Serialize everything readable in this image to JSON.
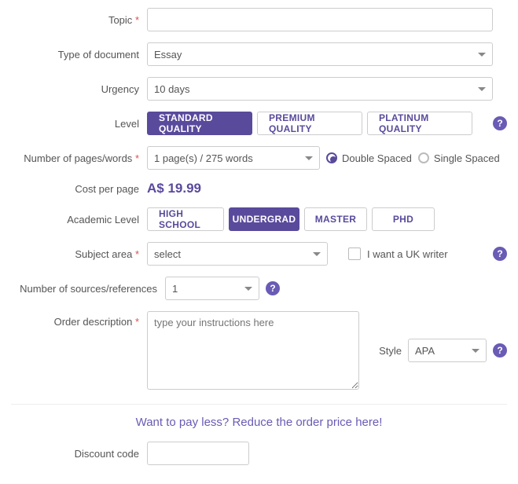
{
  "labels": {
    "topic": "Topic",
    "doc_type": "Type of document",
    "urgency": "Urgency",
    "level": "Level",
    "pages": "Number of pages/words",
    "cost": "Cost per page",
    "academic": "Academic Level",
    "subject": "Subject area",
    "sources": "Number of sources/references",
    "description": "Order description",
    "style": "Style",
    "discount": "Discount code"
  },
  "topic_value": "",
  "doc_type_value": "Essay",
  "urgency_value": "10 days",
  "quality_options": {
    "standard": "STANDARD QUALITY",
    "premium": "PREMIUM QUALITY",
    "platinum": "PLATINUM QUALITY"
  },
  "pages_value": "1 page(s) / 275 words",
  "spacing": {
    "double": "Double Spaced",
    "single": "Single Spaced"
  },
  "cost_value": "A$ 19.99",
  "academic_options": {
    "hs": "HIGH SCHOOL",
    "ug": "UNDERGRAD",
    "ma": "MASTER",
    "phd": "PHD"
  },
  "subject_value": "select",
  "uk_writer_label": "I want a UK writer",
  "sources_value": "1",
  "description_placeholder": "type your instructions here",
  "style_value": "APA",
  "promo_text": "Want to pay less? Reduce the order price here!",
  "discount_value": ""
}
